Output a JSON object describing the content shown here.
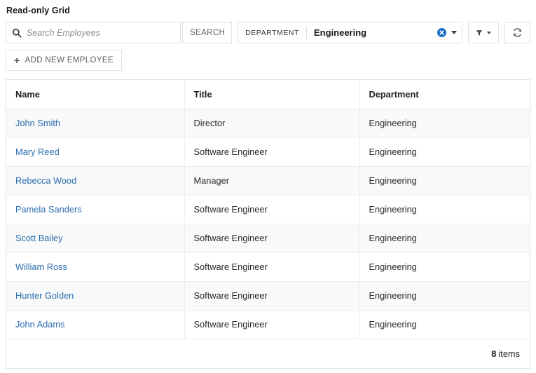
{
  "page": {
    "title": "Read-only Grid"
  },
  "toolbar": {
    "search": {
      "placeholder": "Search Employees",
      "value": "",
      "icon": "search-icon",
      "button_label": "SEARCH"
    },
    "department_filter": {
      "label": "DEPARTMENT",
      "value": "Engineering",
      "clear_icon": "clear-circle-icon",
      "clear_icon_color": "#1a6fc4",
      "dropdown_icon": "chevron-down-icon"
    },
    "filter_button": {
      "icon": "funnel-icon",
      "dropdown_icon": "chevron-down-icon"
    },
    "refresh_button": {
      "icon": "refresh-icon"
    }
  },
  "actions": {
    "add_new_employee": {
      "icon": "plus-icon",
      "label": "ADD NEW EMPLOYEE"
    }
  },
  "grid": {
    "columns": [
      {
        "key": "name",
        "label": "Name"
      },
      {
        "key": "title",
        "label": "Title"
      },
      {
        "key": "department",
        "label": "Department"
      }
    ],
    "rows": [
      {
        "name": "John Smith",
        "title": "Director",
        "department": "Engineering"
      },
      {
        "name": "Mary Reed",
        "title": "Software Engineer",
        "department": "Engineering"
      },
      {
        "name": "Rebecca Wood",
        "title": "Manager",
        "department": "Engineering"
      },
      {
        "name": "Pamela Sanders",
        "title": "Software Engineer",
        "department": "Engineering"
      },
      {
        "name": "Scott Bailey",
        "title": "Software Engineer",
        "department": "Engineering"
      },
      {
        "name": "William Ross",
        "title": "Software Engineer",
        "department": "Engineering"
      },
      {
        "name": "Hunter Golden",
        "title": "Software Engineer",
        "department": "Engineering"
      },
      {
        "name": "John Adams",
        "title": "Software Engineer",
        "department": "Engineering"
      }
    ],
    "footer": {
      "count": "8",
      "count_label": "items"
    }
  },
  "colors": {
    "link": "#2b6cb0",
    "clear_badge": "#1a6fc4",
    "border": "#dee2e6",
    "row_stripe": "#f8f9f9"
  }
}
